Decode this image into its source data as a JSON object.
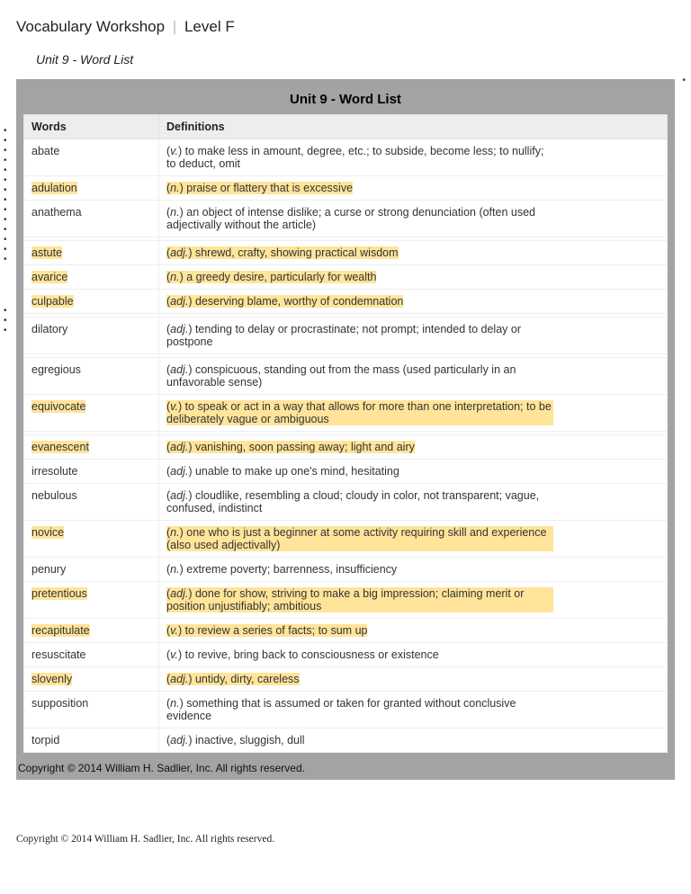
{
  "header": {
    "product": "Vocabulary Workshop",
    "level": "Level F"
  },
  "subhead": "Unit 9 - Word List",
  "panel_title": "Unit 9 - Word List",
  "columns": {
    "words": "Words",
    "definitions": "Definitions"
  },
  "entries": [
    {
      "word": "abate",
      "pos": "v.",
      "def": "to make less in amount, degree, etc.; to subside, become less; to nullify; to deduct, omit",
      "hl": false
    },
    {
      "word": "adulation",
      "pos": "n.",
      "def": "praise or flattery that is excessive",
      "hl": true
    },
    {
      "word": "anathema",
      "pos": "n.",
      "def": "an object of intense dislike; a curse or strong denunciation (often used adjectivally without the article)",
      "hl": false
    },
    {
      "word": "astute",
      "pos": "adj.",
      "def": "shrewd, crafty, showing practical wisdom",
      "hl": true
    },
    {
      "word": "avarice",
      "pos": "n.",
      "def": "a greedy desire, particularly for wealth",
      "hl": true
    },
    {
      "word": "culpable",
      "pos": "adj.",
      "def": "deserving blame, worthy of condemnation",
      "hl": true
    },
    {
      "word": "dilatory",
      "pos": "adj.",
      "def": "tending to delay or procrastinate; not prompt; intended to delay or postpone",
      "hl": false
    },
    {
      "word": "egregious",
      "pos": "adj.",
      "def": "conspicuous, standing out from the mass (used particularly in an unfavorable sense)",
      "hl": false
    },
    {
      "word": "equivocate",
      "pos": "v.",
      "def": "to speak or act in a way that allows for more than one interpretation; to be deliberately vague or ambiguous",
      "hl": true
    },
    {
      "word": "evanescent",
      "pos": "adj.",
      "def": "vanishing, soon passing away; light and airy",
      "hl": true
    },
    {
      "word": "irresolute",
      "pos": "adj.",
      "def": "unable to make up one's mind, hesitating",
      "hl": false
    },
    {
      "word": "nebulous",
      "pos": "adj.",
      "def": "cloudlike, resembling a cloud; cloudy in color, not transparent; vague, confused, indistinct",
      "hl": false
    },
    {
      "word": "novice",
      "pos": "n.",
      "def": "one who is just a beginner at some activity requiring skill and experience (also used adjectivally)",
      "hl": true
    },
    {
      "word": "penury",
      "pos": "n.",
      "def": "extreme poverty; barrenness, insufficiency",
      "hl": false
    },
    {
      "word": "pretentious",
      "pos": "adj.",
      "def": "done for show, striving to make a big impression; claiming merit or position unjustifiably; ambitious",
      "hl": true
    },
    {
      "word": "recapitulate",
      "pos": "v.",
      "def": "to review a series of facts; to sum up",
      "hl": true
    },
    {
      "word": "resuscitate",
      "pos": "v.",
      "def": "to revive, bring back to consciousness or existence",
      "hl": false
    },
    {
      "word": "slovenly",
      "pos": "adj.",
      "def": "untidy, dirty, careless",
      "hl": true
    },
    {
      "word": "supposition",
      "pos": "n.",
      "def": "something that is assumed or taken for granted without conclusive evidence",
      "hl": false
    },
    {
      "word": "torpid",
      "pos": "adj.",
      "def": "inactive, sluggish, dull",
      "hl": false
    }
  ],
  "spacer_after": [
    "anathema",
    "culpable",
    "dilatory",
    "equivocate"
  ],
  "inner_copyright": "Copyright © 2014 William H. Sadlier, Inc. All rights reserved.",
  "outer_copyright": "Copyright © 2014 William H. Sadlier, Inc. All rights reserved."
}
